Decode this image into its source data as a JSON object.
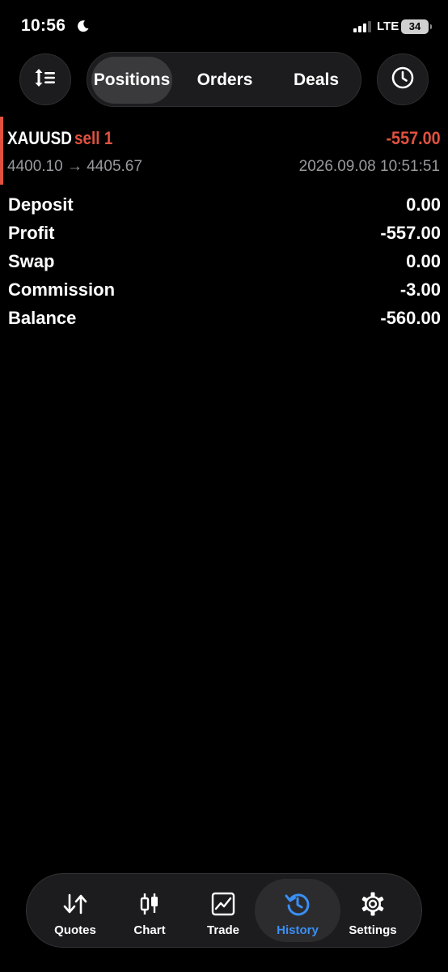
{
  "status_bar": {
    "time": "10:56",
    "network": "LTE",
    "battery": "34"
  },
  "toolbar": {
    "tabs": [
      {
        "label": "Positions",
        "active": true
      },
      {
        "label": "Orders",
        "active": false
      },
      {
        "label": "Deals",
        "active": false
      }
    ]
  },
  "position": {
    "symbol": "XAUUSD",
    "side_volume": "sell 1",
    "profit": "-557.00",
    "prices": "4400.10 → 4405.67",
    "time": "2026.09.08 10:51:51"
  },
  "summary": [
    {
      "label": "Deposit",
      "value": "0.00"
    },
    {
      "label": "Profit",
      "value": "-557.00"
    },
    {
      "label": "Swap",
      "value": "0.00"
    },
    {
      "label": "Commission",
      "value": "-3.00"
    },
    {
      "label": "Balance",
      "value": "-560.00"
    }
  ],
  "nav": [
    {
      "label": "Quotes",
      "icon": "quotes-icon",
      "active": false
    },
    {
      "label": "Chart",
      "icon": "candlestick-icon",
      "active": false
    },
    {
      "label": "Trade",
      "icon": "trade-chart-icon",
      "active": false
    },
    {
      "label": "History",
      "icon": "history-icon",
      "active": true
    },
    {
      "label": "Settings",
      "icon": "gear-icon",
      "active": false
    }
  ],
  "colors": {
    "background": "#000000",
    "loss_red": "#e0523f",
    "accent_blue": "#3a8ff5",
    "secondary_text": "#9a9a9e"
  }
}
